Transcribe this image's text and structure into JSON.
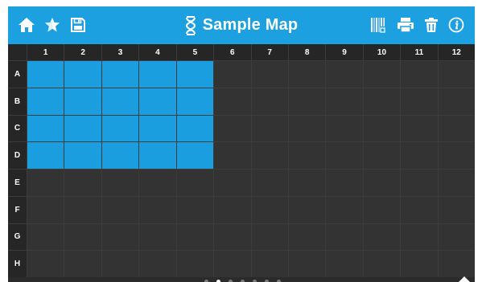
{
  "header": {
    "title": "Sample Map",
    "icons": [
      "home-icon",
      "star-icon",
      "save-icon",
      "dna-icon",
      "barcode-icon",
      "printer-icon",
      "trash-icon",
      "info-icon"
    ],
    "accent_color": "#1ca0e0"
  },
  "plate": {
    "columns": [
      "1",
      "2",
      "3",
      "4",
      "5",
      "6",
      "7",
      "8",
      "9",
      "10",
      "11",
      "12"
    ],
    "rows": [
      "A",
      "B",
      "C",
      "D",
      "E",
      "F",
      "G",
      "H"
    ],
    "selected_rows": [
      "A",
      "B",
      "C",
      "D"
    ],
    "selected_columns": [
      "1",
      "2",
      "3",
      "4",
      "5"
    ],
    "selected_color": "#1a9ee0",
    "empty_color": "#333333"
  },
  "pagination": {
    "page_count": 7,
    "current_page": 2
  }
}
